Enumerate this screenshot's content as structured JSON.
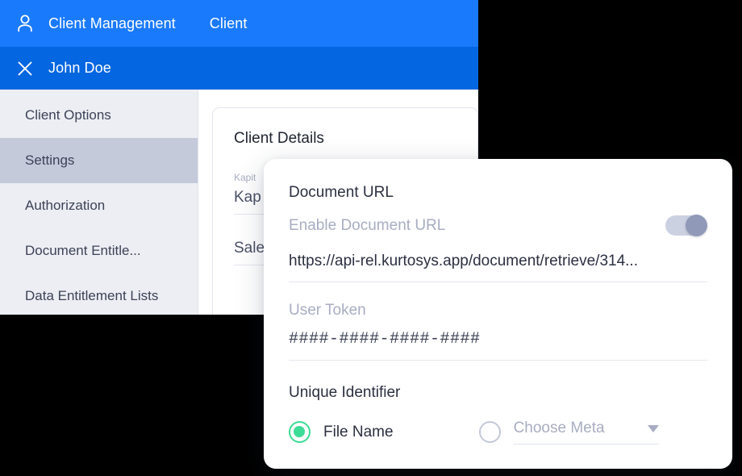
{
  "app": {
    "topbar": {
      "icon": "person-icon",
      "breadcrumb_primary": "Client Management",
      "breadcrumb_secondary": "Client"
    },
    "clientbar": {
      "close_icon": "close-icon",
      "client_name": "John Doe"
    },
    "sidebar": {
      "items": [
        {
          "label": "Client Options",
          "active": false
        },
        {
          "label": "Settings",
          "active": true
        },
        {
          "label": "Authorization",
          "active": false
        },
        {
          "label": "Document Entitle...",
          "active": false
        },
        {
          "label": "Data Entitlement Lists",
          "active": false
        }
      ]
    },
    "details_card": {
      "title": "Client Details",
      "fields": [
        {
          "label": "Kapit",
          "value": "Kap"
        },
        {
          "label": "",
          "value": "Sale"
        }
      ]
    }
  },
  "dialog": {
    "section_title": "Document URL",
    "enable_toggle": {
      "label": "Enable Document URL",
      "state": "on"
    },
    "document_url": "https://api-rel.kurtosys.app/document/retrieve/314...",
    "user_token": {
      "label": "User Token",
      "value": "####-####-####-####"
    },
    "unique_identifier": {
      "title": "Unique Identifier",
      "options": [
        {
          "label": "File Name",
          "selected": true
        },
        {
          "label": "",
          "selected": false
        }
      ],
      "meta_select": {
        "placeholder": "Choose Meta",
        "chevron": "chevron-down-icon"
      }
    }
  },
  "colors": {
    "topbar_blue": "#1a7afc",
    "clientbar_blue": "#0466e0",
    "sidebar_bg": "#eceef3",
    "sidebar_active": "#c5cadb",
    "radio_green": "#3ddc97",
    "toggle_knob": "#9099b8",
    "toggle_track": "#ccd1e2"
  }
}
